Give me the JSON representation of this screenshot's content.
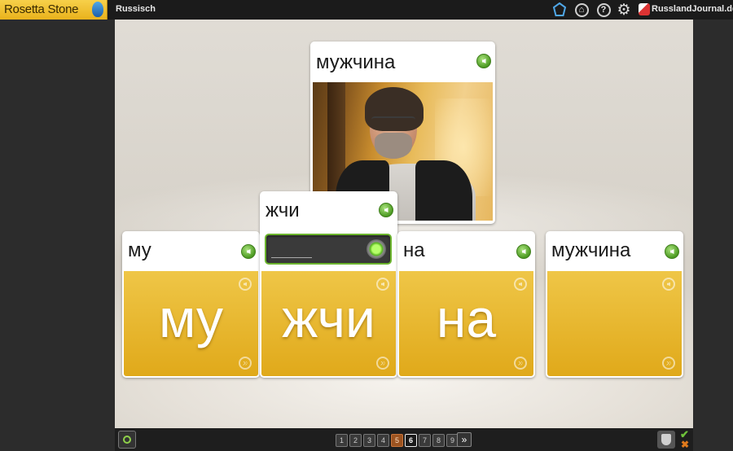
{
  "header": {
    "brand": "Rosetta Stone",
    "course": "Russisch",
    "site": "RusslandJournal.de",
    "icons": [
      "shield-icon",
      "home-icon",
      "help-icon",
      "gear-icon",
      "site-logo-icon"
    ],
    "help_glyph": "?",
    "gear_glyph": "⚙",
    "home_glyph": "⌂"
  },
  "prompt_card": {
    "word": "мужчина",
    "image": "man-photo"
  },
  "syllable_cards": [
    {
      "label": "му",
      "syllable": "му"
    },
    {
      "label": "жчи",
      "syllable": "жчи"
    },
    {
      "label": "на",
      "syllable": "на"
    },
    {
      "label": "мужчина",
      "syllable": ""
    }
  ],
  "answer": {
    "value": "",
    "placeholder": ""
  },
  "footer": {
    "pages": [
      "1",
      "2",
      "3",
      "4",
      "5",
      "6",
      "7",
      "8",
      "9"
    ],
    "done_page": "5",
    "current_page": "6",
    "next_label": "»",
    "check": "✔",
    "cross": "✖"
  },
  "colors": {
    "accent_yellow": "#e9b21c",
    "speaker_green": "#4c9a22",
    "done_orange": "#9c5320"
  }
}
